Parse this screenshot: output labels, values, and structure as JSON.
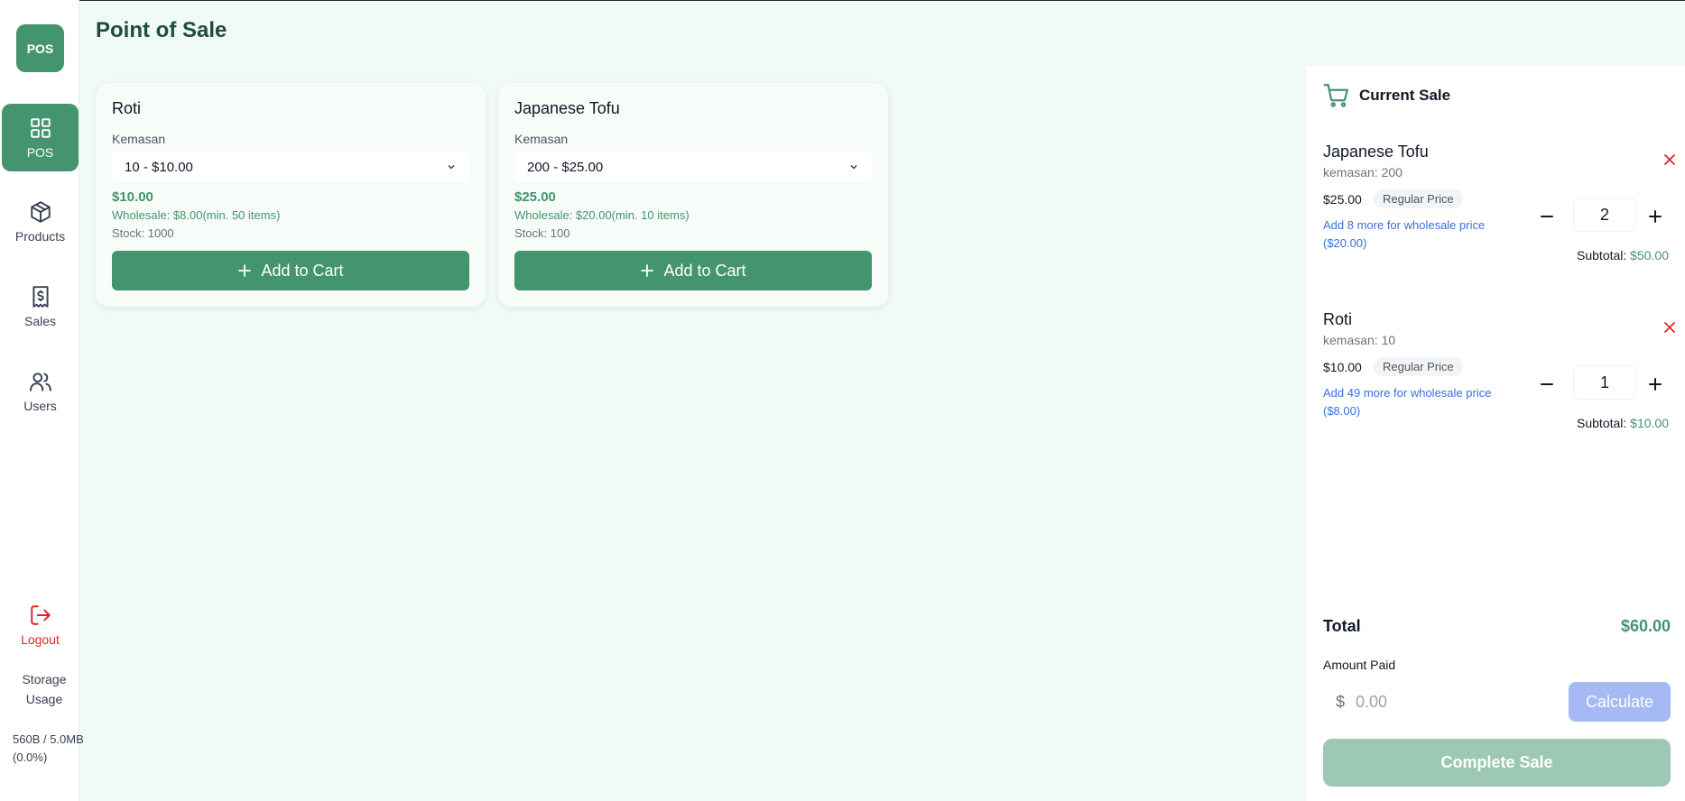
{
  "app": {
    "logo_text": "POS",
    "page_title": "Point of Sale"
  },
  "sidebar": {
    "items": [
      {
        "label": "POS",
        "icon": "grid-icon",
        "active": true
      },
      {
        "label": "Products",
        "icon": "package-icon"
      },
      {
        "label": "Sales",
        "icon": "receipt-icon"
      },
      {
        "label": "Users",
        "icon": "users-icon"
      }
    ],
    "logout": {
      "label": "Logout",
      "icon": "logout-icon"
    },
    "storage": {
      "label": "Storage Usage",
      "value": "560B / 5.0MB (0.0%)"
    }
  },
  "products": [
    {
      "name": "Roti",
      "pack_label": "Kemasan",
      "selected_pack": "10 - $10.00",
      "price": "$10.00",
      "wholesale": "Wholesale: $8.00(min. 50 items)",
      "stock": "Stock: 1000",
      "add_label": "Add to Cart"
    },
    {
      "name": "Japanese Tofu",
      "pack_label": "Kemasan",
      "selected_pack": "200 - $25.00",
      "price": "$25.00",
      "wholesale": "Wholesale: $20.00(min. 10 items)",
      "stock": "Stock: 100",
      "add_label": "Add to Cart"
    }
  ],
  "cart": {
    "title": "Current Sale",
    "items": [
      {
        "name": "Japanese Tofu",
        "pack": "kemasan: 200",
        "price": "$25.00",
        "badge": "Regular Price",
        "hint": "Add 8 more for wholesale price ($20.00)",
        "qty": "2",
        "subtotal_label": "Subtotal:",
        "subtotal": "$50.00"
      },
      {
        "name": "Roti",
        "pack": "kemasan: 10",
        "price": "$10.00",
        "badge": "Regular Price",
        "hint": "Add 49 more for wholesale price ($8.00)",
        "qty": "1",
        "subtotal_label": "Subtotal:",
        "subtotal": "$10.00"
      }
    ],
    "total_label": "Total",
    "total": "$60.00",
    "amount_paid_label": "Amount Paid",
    "currency_symbol": "$",
    "amount_placeholder": "0.00",
    "calculate_label": "Calculate",
    "complete_label": "Complete Sale"
  },
  "colors": {
    "brand": "#449470",
    "danger": "#dc2626",
    "link": "#3b6fd9",
    "calculate": "#a5b9f4"
  }
}
